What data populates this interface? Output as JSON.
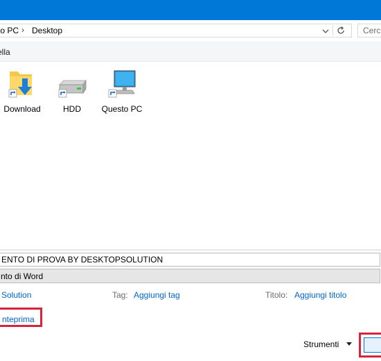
{
  "address_bar": {
    "crumbs": [
      "to PC",
      "Desktop"
    ],
    "separator": "›",
    "search_placeholder": "Cerca"
  },
  "command_bar": {
    "new_folder_label": "ella"
  },
  "files": [
    {
      "name": "Download",
      "icon": "download-folder-icon"
    },
    {
      "name": "HDD",
      "icon": "drive-icon"
    },
    {
      "name": "Questo PC",
      "icon": "computer-icon"
    }
  ],
  "save_form": {
    "filename": "ENTO DI PROVA BY DESKTOPSOLUTION",
    "save_type": "nto di Word"
  },
  "metadata": {
    "author_value": "Solution",
    "tags_label": "Tag:",
    "tags_value": "Aggiungi tag",
    "title_label": "Titolo:",
    "title_value": "Aggiungi titolo"
  },
  "preview": {
    "label": "nteprima"
  },
  "tools": {
    "label": "Strumenti"
  },
  "colors": {
    "titlebar": "#0078d7",
    "link": "#0066cc",
    "highlight": "#d9233a"
  }
}
